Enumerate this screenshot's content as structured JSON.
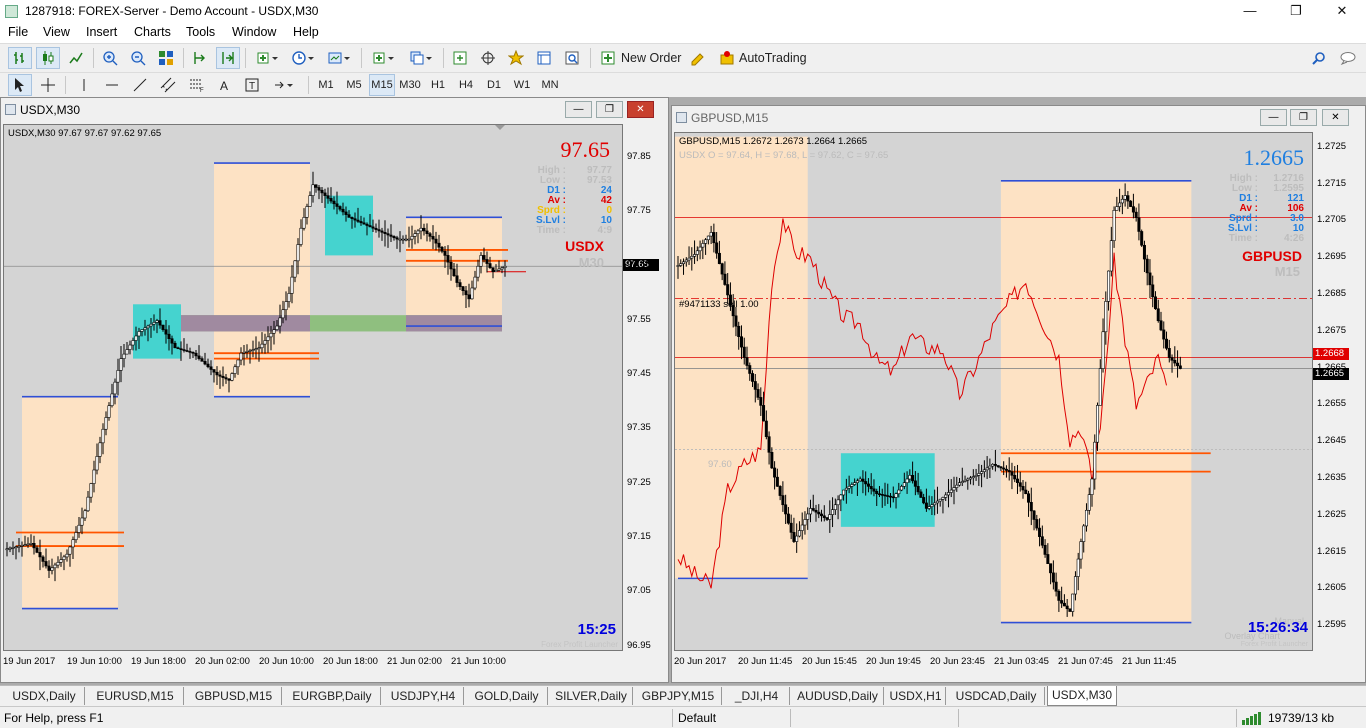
{
  "app": {
    "title": "1287918: FOREX-Server - Demo Account - USDX,M30",
    "minimize_glyph": "—",
    "maximize_glyph": "❐",
    "close_glyph": "✕"
  },
  "menu": [
    "File",
    "View",
    "Insert",
    "Charts",
    "Tools",
    "Window",
    "Help"
  ],
  "toolbar": {
    "new_order": "New Order",
    "autotrading": "AutoTrading",
    "timeframes": [
      "M1",
      "M5",
      "M15",
      "M30",
      "H1",
      "H4",
      "D1",
      "W1",
      "MN"
    ],
    "active_timeframe": "M15"
  },
  "colors": {
    "chart_bg": "#d4d4d4",
    "session_box": "#fde2c4",
    "cyan_box": "#45d3cf",
    "orange_line": "#ff5500",
    "blue_line": "#2f4fd6",
    "red_line": "#dd0000",
    "green_band": "#8fbf7f",
    "purple_band": "#a08aa0"
  },
  "charts": [
    {
      "window_title": "USDX,M30",
      "header": "USDX,M30  97.67 97.67 97.62 97.65",
      "big_price": "97.65",
      "info": [
        {
          "k": "High :",
          "v": "97.77",
          "color": "#bdbdbd"
        },
        {
          "k": "Low :",
          "v": "97.53",
          "color": "#bdbdbd"
        },
        {
          "k": "D1 :",
          "v": "24",
          "color": "#1f7fe0"
        },
        {
          "k": "Av :",
          "v": "42",
          "color": "#e00000"
        },
        {
          "k": "Sprd :",
          "v": "0",
          "color": "#f0c000"
        },
        {
          "k": "S.Lvl :",
          "v": "10",
          "color": "#1f7fe0"
        },
        {
          "k": "Time :",
          "v": "4:9",
          "color": "#bdbdbd"
        }
      ],
      "symbol": "USDX",
      "tf": "M30",
      "clock": "15:25",
      "watermark": "Forex Profit Launcher",
      "price_tag": "97.65",
      "y_ticks": [
        "97.85",
        "97.75",
        "97.65",
        "97.55",
        "97.45",
        "97.35",
        "97.25",
        "97.15",
        "97.05",
        "96.95"
      ],
      "x_ticks": [
        "19 Jun 2017",
        "19 Jun 10:00",
        "19 Jun 18:00",
        "20 Jun 02:00",
        "20 Jun 10:00",
        "20 Jun 18:00",
        "21 Jun 02:00",
        "21 Jun 10:00"
      ]
    },
    {
      "window_title": "GBPUSD,M15",
      "header": "GBPUSD,M15  1.2672 1.2673 1.2664 1.2665",
      "overlay_header": "USDX O = 97.64, H = 97.68, L = 97.62, C = 97.65",
      "big_price": "1.2665",
      "info": [
        {
          "k": "High :",
          "v": "1.2716",
          "color": "#bdbdbd"
        },
        {
          "k": "Low :",
          "v": "1.2595",
          "color": "#bdbdbd"
        },
        {
          "k": "D1 :",
          "v": "121",
          "color": "#1f7fe0"
        },
        {
          "k": "Av :",
          "v": "106",
          "color": "#e00000"
        },
        {
          "k": "Sprd :",
          "v": "3.0",
          "color": "#1f7fe0"
        },
        {
          "k": "S.Lvl :",
          "v": "10",
          "color": "#1f7fe0"
        },
        {
          "k": "Time :",
          "v": "4:26",
          "color": "#bdbdbd"
        }
      ],
      "symbol": "GBPUSD",
      "tf": "M15",
      "clock": "15:26:34",
      "order_label": "#9471133 sell 1.00",
      "overlay_price": "97.60",
      "watermark_a": "Manual",
      "watermark_b": "Overlay Chart",
      "watermark_c": "Forex Profit Launcher",
      "price_tag_ask": "1.2668",
      "price_tag_bid": "1.2665",
      "y_ticks": [
        "1.2725",
        "1.2715",
        "1.2705",
        "1.2695",
        "1.2685",
        "1.2675",
        "1.2665",
        "1.2655",
        "1.2645",
        "1.2635",
        "1.2625",
        "1.2615",
        "1.2605",
        "1.2595"
      ],
      "x_ticks": [
        "20 Jun 2017",
        "20 Jun 11:45",
        "20 Jun 15:45",
        "20 Jun 19:45",
        "20 Jun 23:45",
        "21 Jun 03:45",
        "21 Jun 07:45",
        "21 Jun 11:45"
      ]
    }
  ],
  "chart_data": [
    {
      "type": "candlestick",
      "symbol": "USDX",
      "timeframe": "M30",
      "ylim": [
        96.94,
        97.91
      ],
      "x_ticks": [
        "19 Jun 2017",
        "19 Jun 10:00",
        "19 Jun 18:00",
        "20 Jun 02:00",
        "20 Jun 10:00",
        "20 Jun 18:00",
        "21 Jun 02:00",
        "21 Jun 10:00"
      ],
      "current_price": 97.65,
      "close_anchors": [
        [
          0,
          97.13
        ],
        [
          8,
          97.14
        ],
        [
          14,
          97.09
        ],
        [
          20,
          97.12
        ],
        [
          26,
          97.2
        ],
        [
          32,
          97.35
        ],
        [
          38,
          97.48
        ],
        [
          44,
          97.53
        ],
        [
          50,
          97.55
        ],
        [
          56,
          97.5
        ],
        [
          62,
          97.49
        ],
        [
          66,
          97.47
        ],
        [
          70,
          97.45
        ],
        [
          74,
          97.44
        ],
        [
          78,
          97.49
        ],
        [
          84,
          97.5
        ],
        [
          90,
          97.54
        ],
        [
          94,
          97.6
        ],
        [
          98,
          97.72
        ],
        [
          102,
          97.8
        ],
        [
          106,
          97.78
        ],
        [
          110,
          97.76
        ],
        [
          114,
          97.74
        ],
        [
          118,
          97.73
        ],
        [
          122,
          97.72
        ],
        [
          126,
          97.71
        ],
        [
          130,
          97.7
        ],
        [
          134,
          97.7
        ],
        [
          138,
          97.72
        ],
        [
          142,
          97.7
        ],
        [
          146,
          97.67
        ],
        [
          150,
          97.62
        ],
        [
          154,
          97.59
        ],
        [
          158,
          97.67
        ],
        [
          162,
          97.64
        ],
        [
          166,
          97.65
        ]
      ],
      "levels": [
        97.84,
        97.41,
        97.74,
        97.54,
        97.4,
        97.02,
        97.16,
        97.14,
        97.49,
        97.48,
        97.68,
        97.67,
        97.64
      ]
    },
    {
      "type": "candlestick",
      "symbol": "GBPUSD",
      "timeframe": "M15",
      "ylim": [
        1.2588,
        1.2729
      ],
      "x_ticks": [
        "20 Jun 2017",
        "20 Jun 11:45",
        "20 Jun 15:45",
        "20 Jun 19:45",
        "20 Jun 23:45",
        "21 Jun 03:45",
        "21 Jun 07:45",
        "21 Jun 11:45"
      ],
      "ask": 1.2668,
      "bid": 1.2665,
      "order_level": 1.2684,
      "close_anchors": [
        [
          0,
          1.2693
        ],
        [
          6,
          1.2696
        ],
        [
          12,
          1.2702
        ],
        [
          18,
          1.2685
        ],
        [
          24,
          1.2668
        ],
        [
          30,
          1.2655
        ],
        [
          34,
          1.2638
        ],
        [
          38,
          1.2628
        ],
        [
          42,
          1.2618
        ],
        [
          48,
          1.2627
        ],
        [
          54,
          1.2624
        ],
        [
          60,
          1.2632
        ],
        [
          66,
          1.2635
        ],
        [
          72,
          1.2631
        ],
        [
          78,
          1.263
        ],
        [
          84,
          1.2636
        ],
        [
          90,
          1.2627
        ],
        [
          96,
          1.263
        ],
        [
          102,
          1.2634
        ],
        [
          108,
          1.2636
        ],
        [
          114,
          1.2639
        ],
        [
          120,
          1.2637
        ],
        [
          126,
          1.2631
        ],
        [
          132,
          1.2617
        ],
        [
          138,
          1.2602
        ],
        [
          142,
          1.2599
        ],
        [
          146,
          1.2618
        ],
        [
          150,
          1.2635
        ],
        [
          154,
          1.2675
        ],
        [
          158,
          1.2708
        ],
        [
          162,
          1.2712
        ],
        [
          166,
          1.2706
        ],
        [
          170,
          1.2691
        ],
        [
          174,
          1.2678
        ],
        [
          178,
          1.2668
        ],
        [
          182,
          1.2665
        ]
      ],
      "overlay_usdx": [
        [
          0,
          1.2614
        ],
        [
          6,
          1.2609
        ],
        [
          12,
          1.2606
        ],
        [
          18,
          1.2632
        ],
        [
          24,
          1.2639
        ],
        [
          30,
          1.2643
        ],
        [
          34,
          1.2689
        ],
        [
          38,
          1.2706
        ],
        [
          42,
          1.2697
        ],
        [
          48,
          1.2695
        ],
        [
          54,
          1.2686
        ],
        [
          60,
          1.2679
        ],
        [
          66,
          1.2677
        ],
        [
          72,
          1.2667
        ],
        [
          78,
          1.2664
        ],
        [
          84,
          1.2674
        ],
        [
          90,
          1.2671
        ],
        [
          96,
          1.267
        ],
        [
          102,
          1.2658
        ],
        [
          108,
          1.2666
        ],
        [
          114,
          1.2676
        ],
        [
          120,
          1.2683
        ],
        [
          126,
          1.2689
        ],
        [
          132,
          1.2678
        ],
        [
          138,
          1.2668
        ],
        [
          142,
          1.2646
        ],
        [
          146,
          1.2649
        ],
        [
          150,
          1.2635
        ],
        [
          154,
          1.2656
        ],
        [
          158,
          1.2694
        ],
        [
          162,
          1.2673
        ],
        [
          166,
          1.2655
        ],
        [
          170,
          1.2661
        ],
        [
          174,
          1.2668
        ],
        [
          178,
          1.2655
        ]
      ],
      "levels": [
        1.2716,
        1.2596,
        1.2706,
        1.2684,
        1.2668,
        1.2665,
        1.2642,
        1.2637,
        1.2643,
        1.2632,
        1.2608
      ]
    }
  ],
  "tabs": [
    "USDX,Daily",
    "EURUSD,M15",
    "GBPUSD,M15",
    "EURGBP,Daily",
    "USDJPY,H4",
    "GOLD,Daily",
    "SILVER,Daily",
    "GBPJPY,M15",
    "_DJI,H4",
    "AUDUSD,Daily",
    "USDX,H1",
    "USDCAD,Daily",
    "USDX,M30"
  ],
  "active_tab": "USDX,M30",
  "status": {
    "help": "For Help, press F1",
    "profile": "Default",
    "traffic": "19739/13 kb"
  }
}
